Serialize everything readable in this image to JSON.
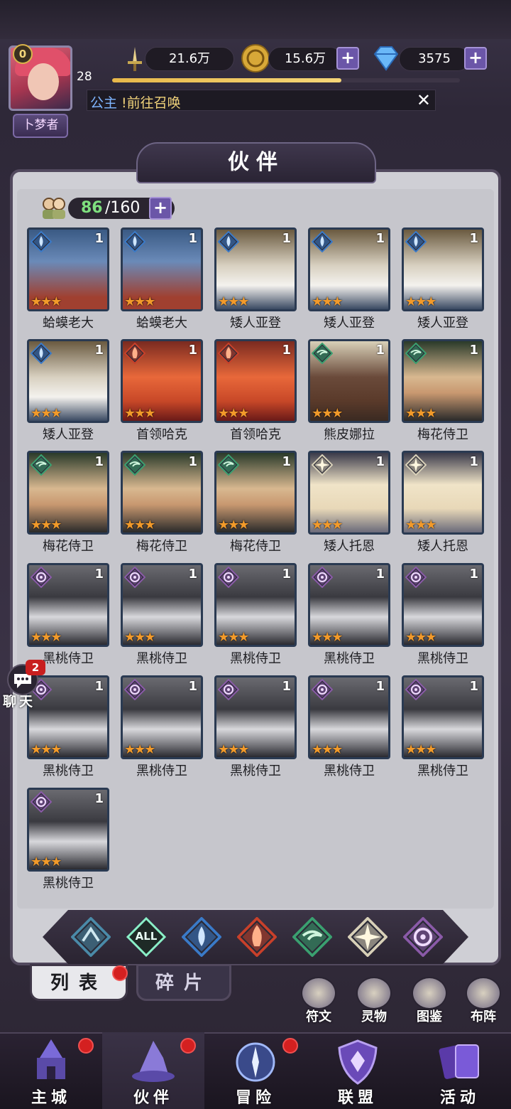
{
  "player": {
    "level_badge": "0",
    "level": "28",
    "xp_fraction": 0.66,
    "rank_title": "卜梦者"
  },
  "resources": {
    "power": "21.6万",
    "gold": "15.6万",
    "gems": "3575"
  },
  "notice": {
    "prefix": "公主",
    "text": "!前往召唤"
  },
  "page_title": "伙伴",
  "partner_count": {
    "current": "86",
    "max": "/160"
  },
  "heroes": [
    {
      "name": "蛤蟆老大",
      "level": "1",
      "element": "water",
      "stars": "★★★",
      "art": "toad"
    },
    {
      "name": "蛤蟆老大",
      "level": "1",
      "element": "water",
      "stars": "★★★",
      "art": "toad"
    },
    {
      "name": "矮人亚登",
      "level": "1",
      "element": "water",
      "stars": "★★★",
      "art": "dwarf"
    },
    {
      "name": "矮人亚登",
      "level": "1",
      "element": "water",
      "stars": "★★★",
      "art": "dwarf"
    },
    {
      "name": "矮人亚登",
      "level": "1",
      "element": "water",
      "stars": "★★★",
      "art": "dwarf"
    },
    {
      "name": "矮人亚登",
      "level": "1",
      "element": "water",
      "stars": "★★★",
      "art": "dwarf"
    },
    {
      "name": "首领哈克",
      "level": "1",
      "element": "fire",
      "stars": "★★★",
      "art": "chief"
    },
    {
      "name": "首领哈克",
      "level": "1",
      "element": "fire",
      "stars": "★★★",
      "art": "chief"
    },
    {
      "name": "熊皮娜拉",
      "level": "1",
      "element": "wind",
      "stars": "★★★",
      "art": "nara"
    },
    {
      "name": "梅花侍卫",
      "level": "1",
      "element": "wind",
      "stars": "★★★",
      "art": "clubguard"
    },
    {
      "name": "梅花侍卫",
      "level": "1",
      "element": "wind",
      "stars": "★★★",
      "art": "clubguard"
    },
    {
      "name": "梅花侍卫",
      "level": "1",
      "element": "wind",
      "stars": "★★★",
      "art": "clubguard"
    },
    {
      "name": "梅花侍卫",
      "level": "1",
      "element": "wind",
      "stars": "★★★",
      "art": "clubguard"
    },
    {
      "name": "矮人托恩",
      "level": "1",
      "element": "light",
      "stars": "★★★",
      "art": "thorn"
    },
    {
      "name": "矮人托恩",
      "level": "1",
      "element": "light",
      "stars": "★★★",
      "art": "thorn"
    },
    {
      "name": "黑桃侍卫",
      "level": "1",
      "element": "dark",
      "stars": "★★★",
      "art": "spadeguard"
    },
    {
      "name": "黑桃侍卫",
      "level": "1",
      "element": "dark",
      "stars": "★★★",
      "art": "spadeguard"
    },
    {
      "name": "黑桃侍卫",
      "level": "1",
      "element": "dark",
      "stars": "★★★",
      "art": "spadeguard"
    },
    {
      "name": "黑桃侍卫",
      "level": "1",
      "element": "dark",
      "stars": "★★★",
      "art": "spadeguard"
    },
    {
      "name": "黑桃侍卫",
      "level": "1",
      "element": "dark",
      "stars": "★★★",
      "art": "spadeguard"
    },
    {
      "name": "黑桃侍卫",
      "level": "1",
      "element": "dark",
      "stars": "★★★",
      "art": "spadeguard"
    },
    {
      "name": "黑桃侍卫",
      "level": "1",
      "element": "dark",
      "stars": "★★★",
      "art": "spadeguard"
    },
    {
      "name": "黑桃侍卫",
      "level": "1",
      "element": "dark",
      "stars": "★★★",
      "art": "spadeguard"
    },
    {
      "name": "黑桃侍卫",
      "level": "1",
      "element": "dark",
      "stars": "★★★",
      "art": "spadeguard"
    },
    {
      "name": "黑桃侍卫",
      "level": "1",
      "element": "dark",
      "stars": "★★★",
      "art": "spadeguard"
    },
    {
      "name": "黑桃侍卫",
      "level": "1",
      "element": "dark",
      "stars": "★★★",
      "art": "spadeguard"
    }
  ],
  "filters": [
    {
      "id": "earth",
      "icon": "earth-element-icon"
    },
    {
      "id": "all",
      "label": "ALL",
      "icon": "all-elements-icon"
    },
    {
      "id": "water",
      "icon": "water-element-icon"
    },
    {
      "id": "fire",
      "icon": "fire-element-icon"
    },
    {
      "id": "wind",
      "icon": "wind-element-icon"
    },
    {
      "id": "light",
      "icon": "light-element-icon"
    },
    {
      "id": "dark",
      "icon": "dark-element-icon"
    }
  ],
  "tabs": {
    "list": "列表",
    "fragments": "碎片"
  },
  "side_buttons": [
    {
      "label": "符文",
      "icon": "rune-icon"
    },
    {
      "label": "灵物",
      "icon": "spirit-icon"
    },
    {
      "label": "图鉴",
      "icon": "codex-icon"
    },
    {
      "label": "布阵",
      "icon": "formation-icon"
    }
  ],
  "chat": {
    "label": "聊天",
    "badge": "2"
  },
  "nav": [
    {
      "label": "主城",
      "icon": "castle-icon",
      "dot": true
    },
    {
      "label": "伙伴",
      "icon": "witch-hat-icon",
      "dot": true
    },
    {
      "label": "冒险",
      "icon": "compass-icon",
      "dot": true
    },
    {
      "label": "联盟",
      "icon": "shield-icon",
      "dot": false
    },
    {
      "label": "活动",
      "icon": "cards-icon",
      "dot": false
    }
  ],
  "colors": {
    "panel": "#cfcfd5",
    "frame": "#52495e",
    "accent": "#6b56a8",
    "star": "#f29a2a",
    "water": "#3a7ac8",
    "fire": "#c8402a",
    "wind": "#3aa070",
    "light": "#d8d0b8",
    "dark": "#8a5aa8"
  }
}
